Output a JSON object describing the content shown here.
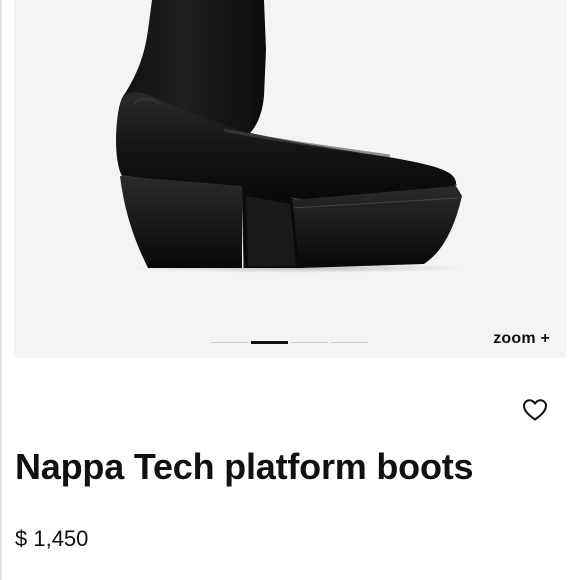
{
  "gallery": {
    "image_alt": "Black leather platform boot",
    "dots_total": 4,
    "active_dot": 1,
    "zoom_label": "zoom +"
  },
  "product": {
    "title": "Nappa Tech platform boots",
    "price": "$ 1,450"
  },
  "icons": {
    "wishlist": "heart-icon"
  },
  "colors": {
    "hero_bg": "#f4f4f4",
    "text": "#111111",
    "dot_inactive": "#cfcfcf"
  }
}
